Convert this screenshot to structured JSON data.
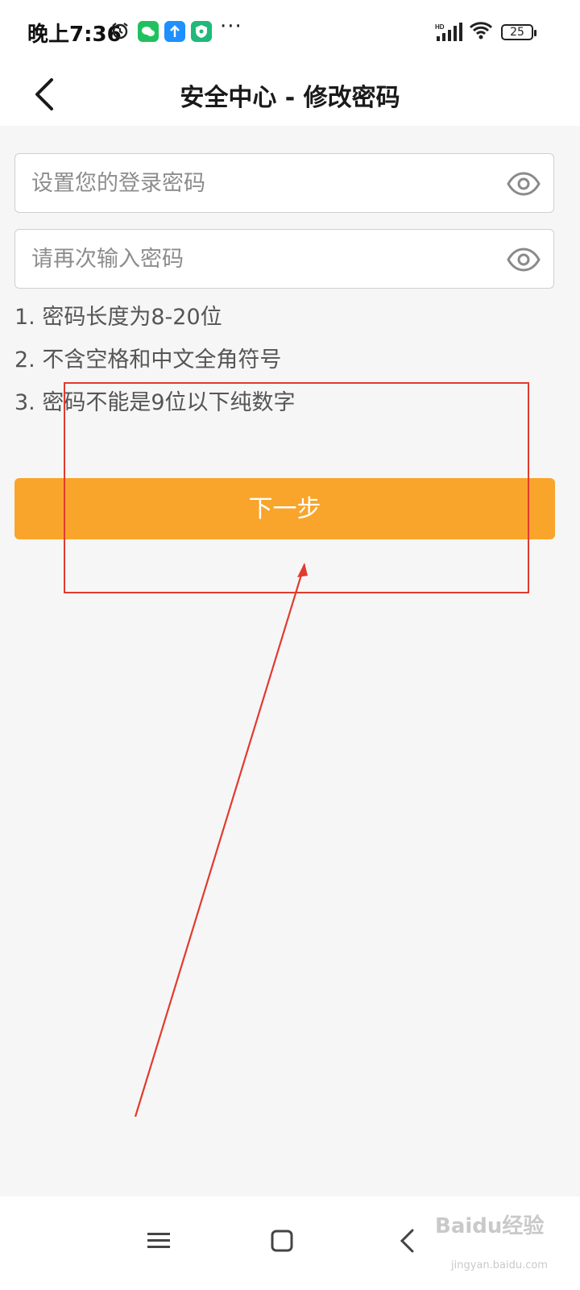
{
  "status_bar": {
    "time": "晚上7:36",
    "more": "···",
    "battery": "25",
    "signal_label": "HD"
  },
  "header": {
    "title": "安全中心 - 修改密码"
  },
  "form": {
    "password_placeholder": "设置您的登录密码",
    "confirm_placeholder": "请再次输入密码",
    "password_value": "",
    "confirm_value": ""
  },
  "rules": [
    "1. 密码长度为8-20位",
    "2. 不含空格和中文全角符号",
    "3. 密码不能是9位以下纯数字"
  ],
  "next_button": {
    "label": "下一步"
  },
  "colors": {
    "accent": "#f9a52b",
    "annotation": "#e23a2e"
  },
  "watermark": {
    "text": "Baidu经验",
    "sub": "jingyan.baidu.com"
  }
}
